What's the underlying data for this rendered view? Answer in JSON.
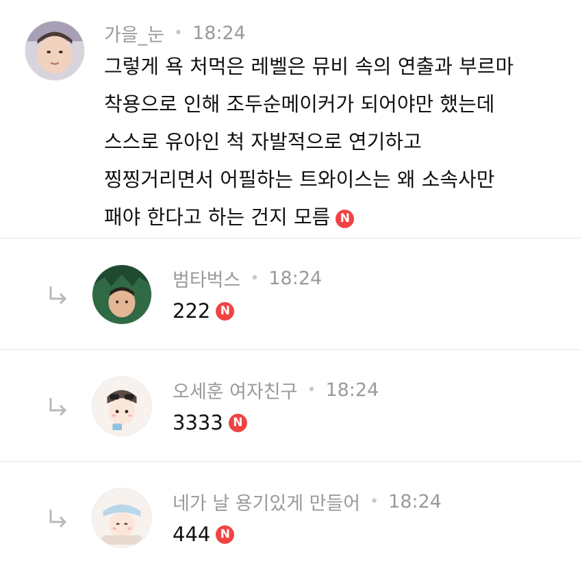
{
  "comments": [
    {
      "author": "가을_눈",
      "time": "18:24",
      "lines": [
        "그렇게 욕 처먹은 레벨은 뮤비 속의 연출과 부르마",
        "착용으로 인해 조두순메이커가 되어야만 했는데",
        "스스로 유아인 척 자발적으로 연기하고",
        "찡찡거리면서 어필하는 트와이스는 왜 소속사만",
        "패야 한다고 하는 건지 모름"
      ],
      "badge": "N"
    }
  ],
  "replies": [
    {
      "author": "범타벅스",
      "time": "18:24",
      "text": "222",
      "badge": "N"
    },
    {
      "author": "오세훈 여자친구",
      "time": "18:24",
      "text": "3333",
      "badge": "N"
    },
    {
      "author": "네가 날 용기있게 만들어",
      "time": "18:24",
      "text": "444",
      "badge": "N"
    }
  ],
  "icons": {
    "reply_arrow": "reply-arrow-icon",
    "new_badge": "new-badge-icon"
  },
  "colors": {
    "badge": "#f04343",
    "meta_text": "#9a9a9a",
    "divider": "#e2e2e2"
  }
}
